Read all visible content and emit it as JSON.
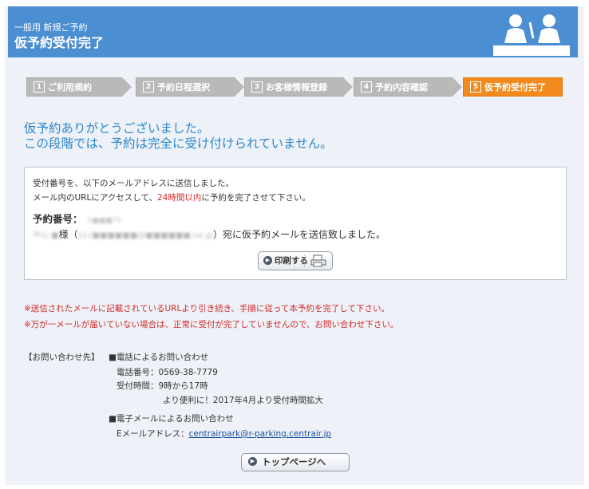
{
  "header": {
    "subtitle": "一般用 新規ご予約",
    "title": "仮予約受付完了"
  },
  "steps": [
    {
      "num": "1",
      "label": "ご利用規約"
    },
    {
      "num": "2",
      "label": "予約日程選択"
    },
    {
      "num": "3",
      "label": "お客様情報登録"
    },
    {
      "num": "4",
      "label": "予約内容確認"
    },
    {
      "num": "5",
      "label": "仮予約受付完了"
    }
  ],
  "current_step": 5,
  "headline": {
    "line1": "仮予約ありがとうございました。",
    "line2": "この段階では、予約は完全に受け付けられていません。"
  },
  "info": {
    "line1": "受付番号を、以下のメールアドレスに送信しました。",
    "line2_before": "メール内のURLにアクセスして、",
    "line2_red": "24時間以内",
    "line2_after": "に予約を完了させて下さい。",
    "reservation_label": "予約番号：",
    "reservation_number": "9■■■76",
    "name": "中山 ■",
    "honorific": "様（",
    "email": "s12■■■■■■@■■■■■■.ne.jp",
    "sent_text": "）宛に仮予約メールを送信致しました。",
    "print_label": "印刷する"
  },
  "notes": [
    "※送信されたメールに記載されているURLより引き続き、手順に従って本予約を完了して下さい。",
    "※万が一メールが届いていない場合は、正常に受付が完了していませんので、お問い合わせ下さい。"
  ],
  "contact": {
    "label": "【お問い合わせ先】",
    "phone_heading": "■電話によるお問い合わせ",
    "phone_number": "電話番号：0569-38-7779",
    "hours": "受付時間：9時から17時",
    "hours_note": "より便利に！2017年4月より受付時間拡大",
    "email_heading": "■電子メールによるお問い合わせ",
    "email_label": "Eメールアドレス：",
    "email_address": "centrairpark@r-parking.centrair.jp"
  },
  "top_button_label": "トップページへ",
  "colors": {
    "header_blue": "#4b8ed2",
    "headline_blue": "#2d86c7",
    "step_active_orange": "#f28a1d",
    "step_inactive_gray": "#b9b9b9",
    "note_red": "#d02a2a"
  }
}
